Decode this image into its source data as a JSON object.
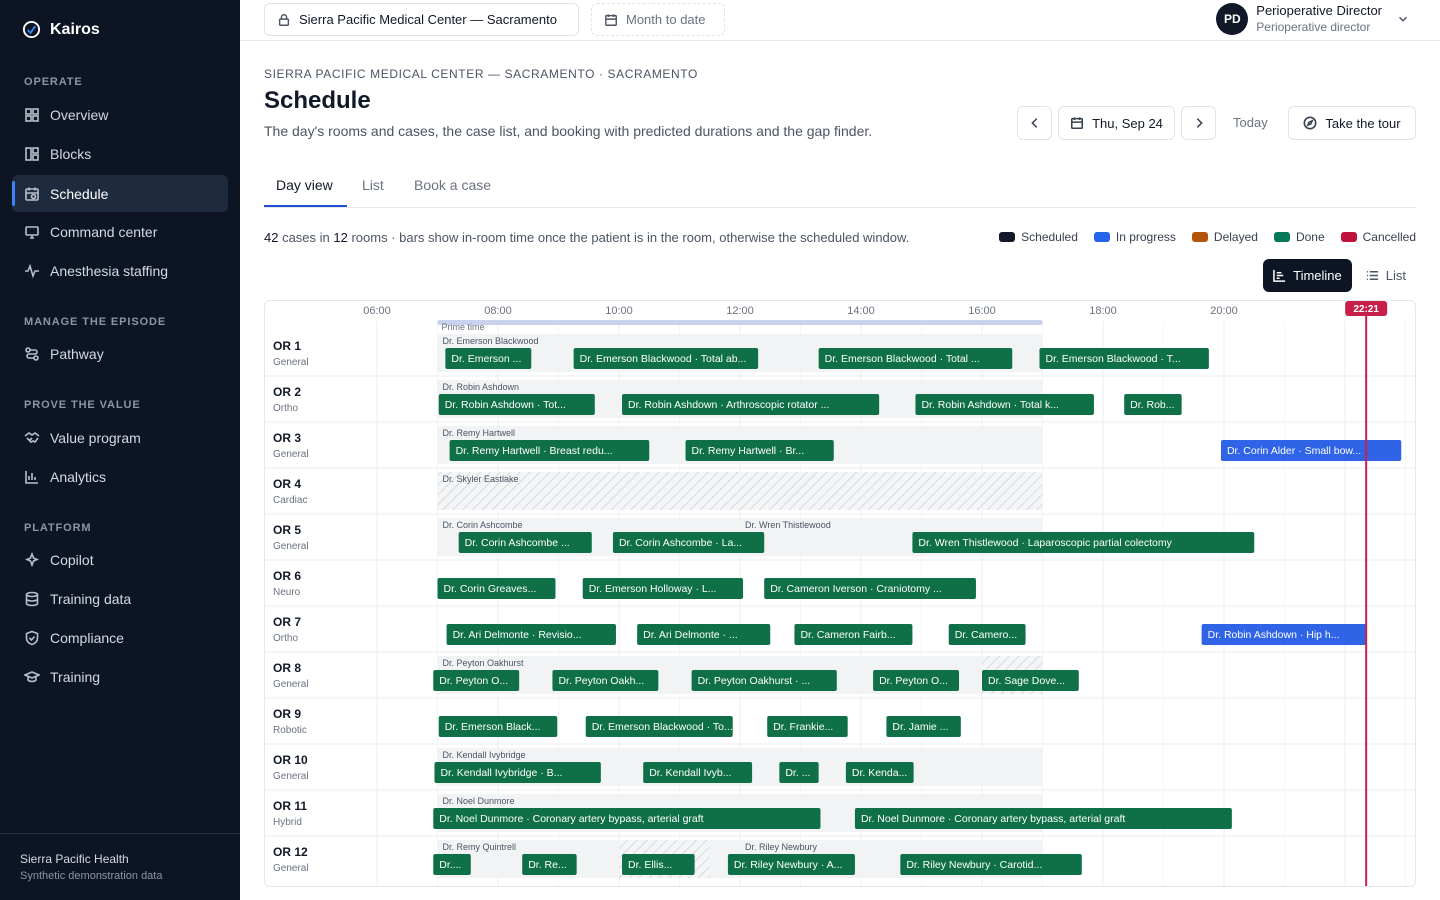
{
  "app": {
    "name": "Kairos"
  },
  "sidebar": {
    "sections": [
      {
        "label": "OPERATE",
        "items": [
          {
            "label": "Overview",
            "icon": "grid-icon"
          },
          {
            "label": "Blocks",
            "icon": "blocks-icon"
          },
          {
            "label": "Schedule",
            "icon": "calendar-clock-icon",
            "active": true
          },
          {
            "label": "Command center",
            "icon": "monitor-icon"
          },
          {
            "label": "Anesthesia staffing",
            "icon": "pulse-icon"
          }
        ]
      },
      {
        "label": "MANAGE THE EPISODE",
        "items": [
          {
            "label": "Pathway",
            "icon": "route-icon"
          }
        ]
      },
      {
        "label": "PROVE THE VALUE",
        "items": [
          {
            "label": "Value program",
            "icon": "handshake-icon"
          },
          {
            "label": "Analytics",
            "icon": "bar-chart-icon"
          }
        ]
      },
      {
        "label": "PLATFORM",
        "items": [
          {
            "label": "Copilot",
            "icon": "sparkles-icon"
          },
          {
            "label": "Training data",
            "icon": "database-icon"
          },
          {
            "label": "Compliance",
            "icon": "shield-icon"
          },
          {
            "label": "Training",
            "icon": "graduation-cap-icon"
          }
        ]
      }
    ],
    "footer": {
      "org": "Sierra Pacific Health",
      "note": "Synthetic demonstration data"
    }
  },
  "topbar": {
    "facility": "Sierra Pacific Medical Center — Sacramento",
    "period": "Month to date",
    "user": {
      "initials": "PD",
      "name": "Perioperative Director",
      "role": "Perioperative director"
    }
  },
  "header": {
    "eyebrow": "SIERRA PACIFIC MEDICAL CENTER — SACRAMENTO · SACRAMENTO",
    "title": "Schedule",
    "subtitle": "The day's rooms and cases, the case list, and booking with predicted durations and the gap finder.",
    "date": "Thu, Sep 24",
    "today": "Today",
    "tour": "Take the tour"
  },
  "tabs": [
    "Day view",
    "List",
    "Book a case"
  ],
  "summary": {
    "cases": "42",
    "cases_text": " cases in ",
    "rooms": "12",
    "rest": " rooms · bars show in-room time once the patient is in the room, otherwise the scheduled window."
  },
  "legend": [
    {
      "label": "Scheduled",
      "color": "#111827"
    },
    {
      "label": "In progress",
      "color": "#2563eb"
    },
    {
      "label": "Delayed",
      "color": "#b45309"
    },
    {
      "label": "Done",
      "color": "#047857"
    },
    {
      "label": "Cancelled",
      "color": "#be123c"
    }
  ],
  "view_toggle": {
    "timeline": "Timeline",
    "list": "List"
  },
  "colors": {
    "done": "#0f7048",
    "in_progress": "#2f64e6",
    "now": "#c81e4a",
    "prime": "#c9d3ee"
  },
  "timeline": {
    "hours": [
      "06:00",
      "08:00",
      "10:00",
      "12:00",
      "14:00",
      "16:00",
      "18:00",
      "20:00"
    ],
    "now_label": "22:21",
    "prime_label": "Prime time",
    "rooms": [
      {
        "name": "OR 1",
        "type": "General",
        "blocks": [
          {
            "label": "Dr. Emerson Blackwood",
            "start": 7.0,
            "end": 17.0
          }
        ],
        "cases": [
          {
            "label": "Dr. Emerson ...",
            "start": 7.13,
            "end": 8.55,
            "status": "done"
          },
          {
            "label": "Dr. Emerson Blackwood · Total ab...",
            "start": 9.25,
            "end": 12.3,
            "status": "done"
          },
          {
            "label": "Dr. Emerson Blackwood · Total ...",
            "start": 13.3,
            "end": 16.5,
            "status": "done"
          },
          {
            "label": "Dr. Emerson Blackwood · T...",
            "start": 16.95,
            "end": 19.75,
            "status": "done"
          }
        ]
      },
      {
        "name": "OR 2",
        "type": "Ortho",
        "blocks": [
          {
            "label": "Dr. Robin Ashdown",
            "start": 7.0,
            "end": 17.0
          }
        ],
        "cases": [
          {
            "label": "Dr. Robin Ashdown · Tot...",
            "start": 7.02,
            "end": 9.6,
            "status": "done"
          },
          {
            "label": "Dr. Robin Ashdown · Arthroscopic rotator ...",
            "start": 10.05,
            "end": 14.3,
            "status": "done"
          },
          {
            "label": "Dr. Robin Ashdown · Total k...",
            "start": 14.9,
            "end": 17.85,
            "status": "done"
          },
          {
            "label": "Dr. Rob...",
            "start": 18.35,
            "end": 19.3,
            "status": "done"
          }
        ]
      },
      {
        "name": "OR 3",
        "type": "General",
        "blocks": [
          {
            "label": "Dr. Remy Hartwell",
            "start": 7.0,
            "end": 17.0
          }
        ],
        "cases": [
          {
            "label": "Dr. Remy Hartwell · Breast redu...",
            "start": 7.2,
            "end": 10.5,
            "status": "done"
          },
          {
            "label": "Dr. Remy Hartwell · Br...",
            "start": 11.1,
            "end": 13.55,
            "status": "done"
          },
          {
            "label": "Dr. Corin Alder · Small bow...",
            "start": 19.95,
            "end": 22.93,
            "status": "in_progress"
          }
        ]
      },
      {
        "name": "OR 4",
        "type": "Cardiac",
        "blocks": [
          {
            "label": "Dr. Skyler Eastlake",
            "start": 7.0,
            "end": 17.0,
            "hatched": true
          }
        ],
        "cases": []
      },
      {
        "name": "OR 5",
        "type": "General",
        "blocks": [
          {
            "label": "Dr. Corin Ashcombe",
            "start": 7.0,
            "end": 12.0
          },
          {
            "label": "Dr. Wren Thistlewood",
            "start": 12.0,
            "end": 17.0
          }
        ],
        "cases": [
          {
            "label": "Dr. Corin Ashcombe ...",
            "start": 7.35,
            "end": 9.55,
            "status": "done"
          },
          {
            "label": "Dr. Corin Ashcombe · La...",
            "start": 9.9,
            "end": 12.4,
            "status": "done"
          },
          {
            "label": "Dr. Wren Thistlewood · Laparoscopic partial colectomy",
            "start": 14.85,
            "end": 20.5,
            "status": "done"
          }
        ]
      },
      {
        "name": "OR 6",
        "type": "Neuro",
        "blocks": [],
        "cases": [
          {
            "label": "Dr. Corin Greaves...",
            "start": 7.0,
            "end": 8.95,
            "status": "done"
          },
          {
            "label": "Dr. Emerson Holloway · L...",
            "start": 9.4,
            "end": 12.05,
            "status": "done"
          },
          {
            "label": "Dr. Cameron Iverson · Craniotomy ...",
            "start": 12.4,
            "end": 15.9,
            "status": "done"
          }
        ]
      },
      {
        "name": "OR 7",
        "type": "Ortho",
        "blocks": [],
        "cases": [
          {
            "label": "Dr. Ari Delmonte · Revisio...",
            "start": 7.15,
            "end": 9.95,
            "status": "done"
          },
          {
            "label": "Dr. Ari Delmonte · ...",
            "start": 10.3,
            "end": 12.5,
            "status": "done"
          },
          {
            "label": "Dr. Cameron Fairb...",
            "start": 12.9,
            "end": 14.85,
            "status": "done"
          },
          {
            "label": "Dr. Camero...",
            "start": 15.45,
            "end": 16.72,
            "status": "done"
          },
          {
            "label": "Dr. Robin Ashdown · Hip h...",
            "start": 19.63,
            "end": 22.35,
            "status": "in_progress"
          }
        ]
      },
      {
        "name": "OR 8",
        "type": "General",
        "blocks": [
          {
            "label": "Dr. Peyton Oakhurst",
            "start": 7.0,
            "end": 17.0,
            "hatch_from": 16.0
          }
        ],
        "cases": [
          {
            "label": "Dr. Peyton O...",
            "start": 6.93,
            "end": 8.35,
            "status": "done"
          },
          {
            "label": "Dr. Peyton Oakh...",
            "start": 8.9,
            "end": 10.65,
            "status": "done"
          },
          {
            "label": "Dr. Peyton Oakhurst · ...",
            "start": 11.2,
            "end": 13.6,
            "status": "done"
          },
          {
            "label": "Dr. Peyton O...",
            "start": 14.2,
            "end": 15.62,
            "status": "done"
          },
          {
            "label": "Dr. Sage Dove...",
            "start": 16.0,
            "end": 17.6,
            "status": "done"
          }
        ]
      },
      {
        "name": "OR 9",
        "type": "Robotic",
        "blocks": [],
        "cases": [
          {
            "label": "Dr. Emerson Black...",
            "start": 7.02,
            "end": 8.98,
            "status": "done"
          },
          {
            "label": "Dr. Emerson Blackwood · To...",
            "start": 9.45,
            "end": 11.88,
            "status": "done"
          },
          {
            "label": "Dr. Frankie...",
            "start": 12.45,
            "end": 13.78,
            "status": "done"
          },
          {
            "label": "Dr. Jamie ...",
            "start": 14.42,
            "end": 15.65,
            "status": "done"
          }
        ]
      },
      {
        "name": "OR 10",
        "type": "General",
        "blocks": [
          {
            "label": "Dr. Kendall Ivybridge",
            "start": 7.0,
            "end": 17.0
          }
        ],
        "cases": [
          {
            "label": "Dr. Kendall Ivybridge · B...",
            "start": 6.95,
            "end": 9.7,
            "status": "done"
          },
          {
            "label": "Dr. Kendall Ivyb...",
            "start": 10.4,
            "end": 12.2,
            "status": "done"
          },
          {
            "label": "Dr. ...",
            "start": 12.65,
            "end": 13.3,
            "status": "done"
          },
          {
            "label": "Dr. Kenda...",
            "start": 13.75,
            "end": 14.87,
            "status": "done"
          }
        ]
      },
      {
        "name": "OR 11",
        "type": "Hybrid",
        "blocks": [
          {
            "label": "Dr. Noel Dunmore",
            "start": 7.0,
            "end": 17.0
          }
        ],
        "cases": [
          {
            "label": "Dr. Noel Dunmore · Coronary artery bypass, arterial graft",
            "start": 6.93,
            "end": 13.33,
            "status": "done"
          },
          {
            "label": "Dr. Noel Dunmore · Coronary artery bypass, arterial graft",
            "start": 13.9,
            "end": 20.13,
            "status": "done"
          }
        ]
      },
      {
        "name": "OR 12",
        "type": "General",
        "blocks": [
          {
            "label": "Dr. Remy Quintrell",
            "start": 7.0,
            "end": 12.0,
            "hatch_range": [
              10.0,
              11.5
            ]
          },
          {
            "label": "Dr. Riley Newbury",
            "start": 12.0,
            "end": 17.0
          }
        ],
        "cases": [
          {
            "label": "Dr....",
            "start": 6.93,
            "end": 7.55,
            "status": "done"
          },
          {
            "label": "Dr. Re...",
            "start": 8.4,
            "end": 9.3,
            "status": "done"
          },
          {
            "label": "Dr. Ellis...",
            "start": 10.05,
            "end": 11.25,
            "status": "done"
          },
          {
            "label": "Dr. Riley Newbury · A...",
            "start": 11.8,
            "end": 13.9,
            "status": "done"
          },
          {
            "label": "Dr. Riley Newbury · Carotid...",
            "start": 14.65,
            "end": 17.65,
            "status": "done"
          }
        ]
      }
    ]
  }
}
